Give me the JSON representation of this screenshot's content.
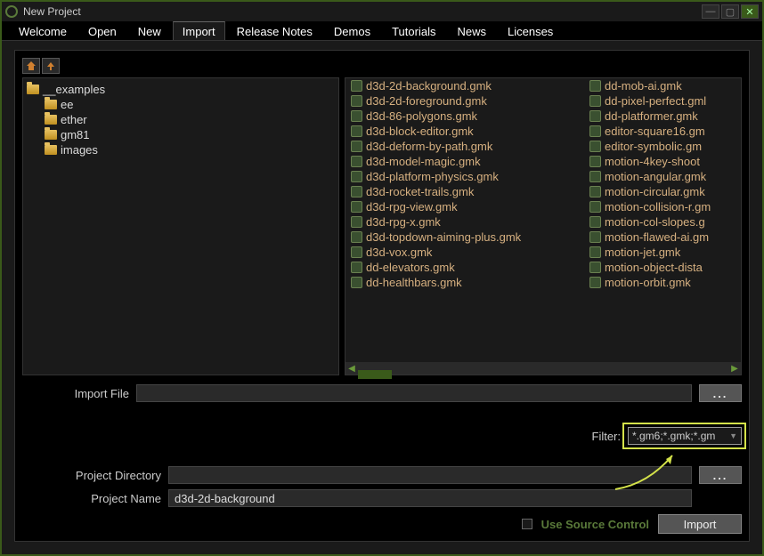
{
  "titlebar": {
    "title": "New Project"
  },
  "tabs": [
    {
      "label": "Welcome"
    },
    {
      "label": "Open"
    },
    {
      "label": "New"
    },
    {
      "label": "Import"
    },
    {
      "label": "Release Notes"
    },
    {
      "label": "Demos"
    },
    {
      "label": "Tutorials"
    },
    {
      "label": "News"
    },
    {
      "label": "Licenses"
    }
  ],
  "active_tab": "Import",
  "tree": {
    "root": {
      "label": "__examples"
    },
    "children": [
      {
        "label": "ee"
      },
      {
        "label": "ether"
      },
      {
        "label": "gm81"
      },
      {
        "label": "images"
      }
    ]
  },
  "files_col1": [
    "d3d-2d-background.gmk",
    "d3d-2d-foreground.gmk",
    "d3d-86-polygons.gmk",
    "d3d-block-editor.gmk",
    "d3d-deform-by-path.gmk",
    "d3d-model-magic.gmk",
    "d3d-platform-physics.gmk",
    "d3d-rocket-trails.gmk",
    "d3d-rpg-view.gmk",
    "d3d-rpg-x.gmk",
    "d3d-topdown-aiming-plus.gmk",
    "d3d-vox.gmk",
    "dd-elevators.gmk",
    "dd-healthbars.gmk"
  ],
  "files_col2": [
    "dd-mob-ai.gmk",
    "dd-pixel-perfect.gml",
    "dd-platformer.gmk",
    "editor-square16.gm",
    "editor-symbolic.gm",
    "motion-4key-shoot",
    "motion-angular.gmk",
    "motion-circular.gmk",
    "motion-collision-r.gm",
    "motion-col-slopes.g",
    "motion-flawed-ai.gm",
    "motion-jet.gmk",
    "motion-object-dista",
    "motion-orbit.gmk"
  ],
  "form": {
    "import_file_label": "Import File",
    "import_file_value": "",
    "browse_label": "...",
    "filter_label": "Filter:",
    "filter_value": "*.gm6;*.gmk;*.gm",
    "project_dir_label": "Project Directory",
    "project_dir_value": "",
    "project_name_label": "Project Name",
    "project_name_value": "d3d-2d-background",
    "use_src_label": "Use Source Control",
    "import_btn": "Import"
  }
}
